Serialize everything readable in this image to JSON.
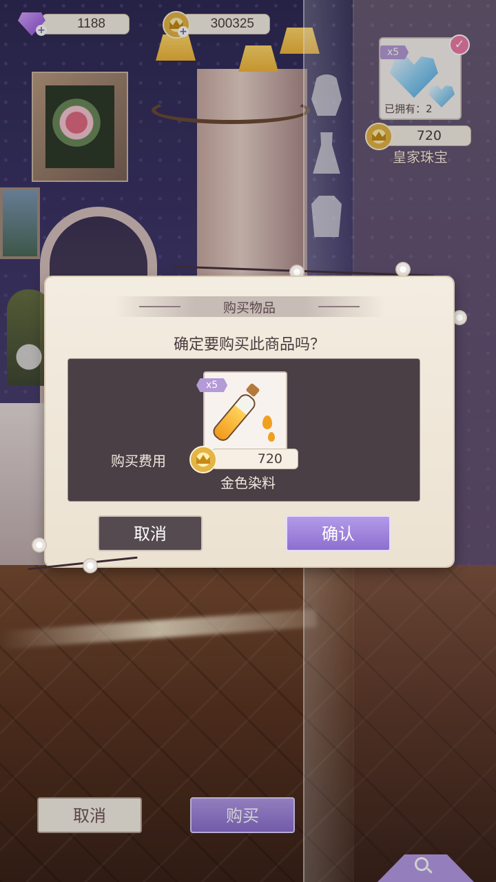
{
  "currency": {
    "diamonds": "1188",
    "coins": "300325"
  },
  "item": {
    "quantity_badge": "x5",
    "owned": "已拥有：2",
    "price": "720",
    "name": "皇家珠宝",
    "selected": true
  },
  "bottom": {
    "cancel_label": "取消",
    "buy_label": "购买"
  },
  "dialog": {
    "title": "购买物品",
    "question": "确定要购买此商品吗？",
    "cost_label": "购买费用",
    "product_badge": "x5",
    "product_price": "720",
    "product_name": "金色染料",
    "cancel_label": "取消",
    "confirm_label": "确认"
  },
  "categories": [
    "hair-icon",
    "dress-icon",
    "coat-icon"
  ],
  "icons": {
    "diamond": "diamond-icon",
    "coin": "coin-icon",
    "search": "search-icon"
  },
  "colors": {
    "accent_purple": "#a68ae0",
    "check_pink": "#ee7aa8",
    "dialog_bg": "#f1e9dc",
    "content_box": "#4a3f45"
  }
}
